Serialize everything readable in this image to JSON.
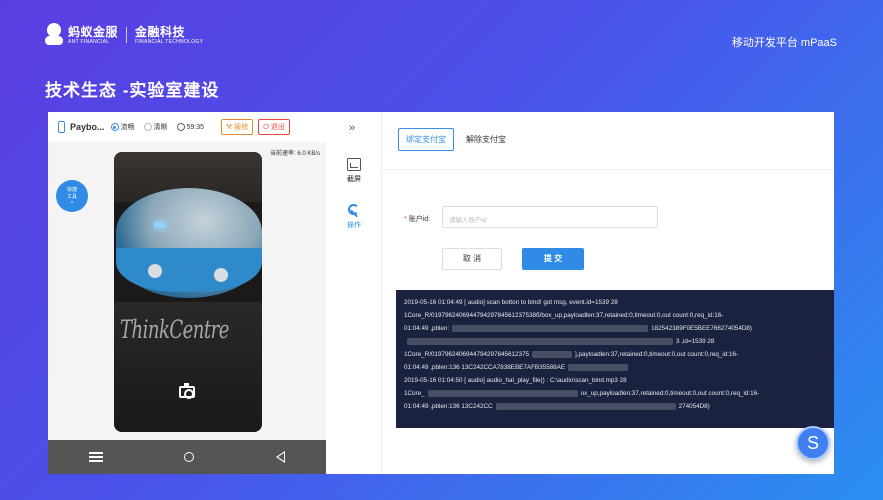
{
  "header": {
    "logo_cn": "蚂蚁金服",
    "logo_en": "ANT FINANCIAL",
    "logo_secondary": "金融科技",
    "logo_secondary_en": "FINANCIAL TECHNOLOGY",
    "platform": "移动开发平台 mPaaS"
  },
  "page": {
    "title": "技术生态 -实验室建设"
  },
  "device_bar": {
    "device_name": "Paybo...",
    "quality_options": [
      "流畅",
      "清晰"
    ],
    "selected_quality": "流畅",
    "timer": "59:35",
    "report_label": "报修",
    "exit_label": "退出",
    "speed_text": "当前速率: 6.0 KB/s"
  },
  "float_ball": {
    "line1": "快捷",
    "line2": "工具"
  },
  "screen": {
    "brand_text": "ThinkCentre"
  },
  "tools": {
    "screenshot_label": "截屏",
    "operate_label": "操作"
  },
  "form": {
    "tab_bind": "绑定支付宝",
    "tab_unbind": "解除支付宝",
    "field_label": "账户id:",
    "field_placeholder": "请输入账户id",
    "cancel_label": "取 消",
    "submit_label": "提 交"
  },
  "log": {
    "lines": [
      "2019-05-16 01:04:49 [ audio] scan botton to bind!  got msg, event.id=1539 28",
      "1Core_R/019796240694479429784561237538б/box_up,payloadlen:37,retained:0,timeout:0,out count:0,req_id:16-",
      "01:04:49 ,pblen:",
      "182542389F0E5BEE766274054D8)",
      "3 ,id=1539 28",
      "1Core_R/0197962406944794297845612375",
      "],payloadlen:37,retained:0,timeout:0,out count:0,req_id:16-",
      "01:04:49 ,pblen:136 13C242CCA7838EBE7AFB35588AE",
      "2019-05-16 01:04:50 [ audio] audio_hal_play_file() : C:\\audio\\scan_bind.mp3 28",
      "1Core_",
      "ox_up,payloadlen:37,retained:0,timeout:0,out count:0,req_id:16-",
      "01:04:49 ,pblen:136 13C242CC",
      "274054D8)"
    ]
  },
  "badge": {
    "letter": "S"
  },
  "colors": {
    "accent": "#2f8be6",
    "log_bg": "#1b2240",
    "danger": "#e44444",
    "warning": "#e88a2e"
  }
}
